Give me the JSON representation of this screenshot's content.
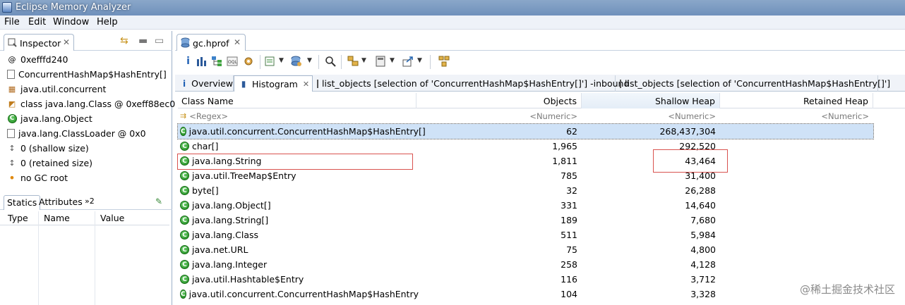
{
  "window": {
    "title": "Eclipse Memory Analyzer"
  },
  "menu": [
    "File",
    "Edit",
    "Window",
    "Help"
  ],
  "inspector": {
    "tab_label": "Inspector",
    "lines": [
      {
        "icon": "at-icon",
        "glyph": "@",
        "text": "0xefffd240"
      },
      {
        "icon": "document-icon",
        "glyph": "▯",
        "text": "ConcurrentHashMap$HashEntry[]"
      },
      {
        "icon": "package-icon",
        "glyph": "▦",
        "text": "java.util.concurrent"
      },
      {
        "icon": "class-file-icon",
        "glyph": "▯",
        "text": "class java.lang.Class @ 0xeff88ec0"
      },
      {
        "icon": "class-icon",
        "glyph": "C",
        "text": "java.lang.Object"
      },
      {
        "icon": "classloader-icon",
        "glyph": "▯",
        "text": "java.lang.ClassLoader @ 0x0"
      },
      {
        "icon": "size-icon",
        "glyph": "↕",
        "text": "0 (shallow size)"
      },
      {
        "icon": "size-icon",
        "glyph": "↕",
        "text": "0 (retained size)"
      },
      {
        "icon": "gc-root-icon",
        "glyph": "•",
        "text": "no GC root"
      }
    ],
    "bottom_tabs": [
      "Statics",
      "Attributes",
      "»2"
    ],
    "columns": [
      "Type",
      "Name",
      "Value"
    ]
  },
  "editor": {
    "tab_label": "gc.hprof",
    "subtabs": [
      {
        "label": "Overview",
        "icon": "info-icon"
      },
      {
        "label": "Histogram",
        "icon": "histogram-icon"
      },
      {
        "label": "list_objects [selection of 'ConcurrentHashMap$HashEntry[]'] -inbound",
        "icon": "list-icon"
      },
      {
        "label": "list_objects [selection of 'ConcurrentHashMap$HashEntry[]']",
        "icon": "list-icon"
      }
    ]
  },
  "table": {
    "columns": [
      "Class Name",
      "Objects",
      "Shallow Heap",
      "Retained Heap"
    ],
    "filters": [
      "<Regex>",
      "<Numeric>",
      "<Numeric>",
      "<Numeric>"
    ],
    "rows": [
      {
        "name": "java.util.concurrent.ConcurrentHashMap$HashEntry[]",
        "objects": "62",
        "shallow": "268,437,304"
      },
      {
        "name": "char[]",
        "objects": "1,965",
        "shallow": "292,520"
      },
      {
        "name": "java.lang.String",
        "objects": "1,811",
        "shallow": "43,464"
      },
      {
        "name": "java.util.TreeMap$Entry",
        "objects": "785",
        "shallow": "31,400"
      },
      {
        "name": "byte[]",
        "objects": "32",
        "shallow": "26,288"
      },
      {
        "name": "java.lang.Object[]",
        "objects": "331",
        "shallow": "14,640"
      },
      {
        "name": "java.lang.String[]",
        "objects": "189",
        "shallow": "7,680"
      },
      {
        "name": "java.lang.Class",
        "objects": "511",
        "shallow": "5,984"
      },
      {
        "name": "java.net.URL",
        "objects": "75",
        "shallow": "4,800"
      },
      {
        "name": "java.lang.Integer",
        "objects": "258",
        "shallow": "4,128"
      },
      {
        "name": "java.util.Hashtable$Entry",
        "objects": "116",
        "shallow": "3,712"
      },
      {
        "name": "java.util.concurrent.ConcurrentHashMap$HashEntry",
        "objects": "104",
        "shallow": "3,328"
      }
    ]
  },
  "watermark": "@稀土掘金技术社区"
}
